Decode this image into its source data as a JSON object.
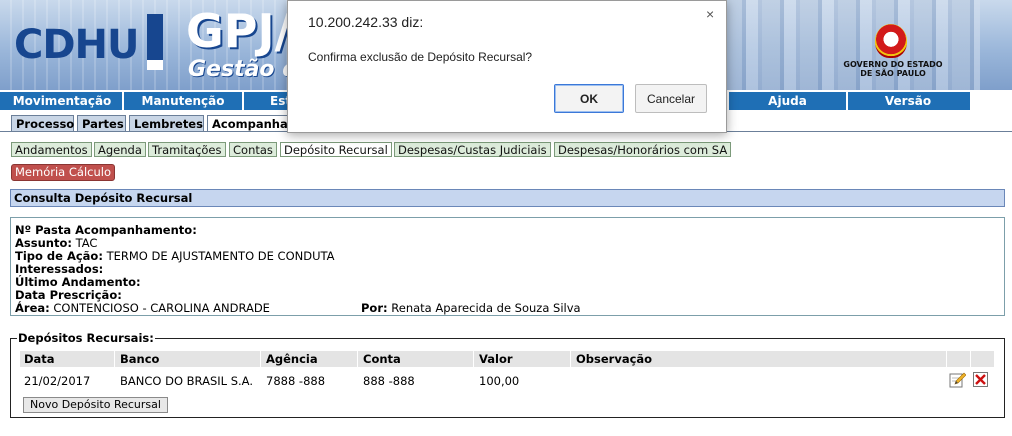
{
  "header": {
    "logo_left": "CDHU",
    "logo_main": "GPJ/",
    "logo_sub": "Gestão d",
    "gov_line1": "GOVERNO DO ESTADO",
    "gov_line2": "DE SÃO PAULO"
  },
  "menu": {
    "items": [
      {
        "label": "Movimentação"
      },
      {
        "label": "Manutenção"
      },
      {
        "label": "Est"
      },
      {
        "label": "Ajuda"
      },
      {
        "label": "Versão"
      }
    ]
  },
  "tabs": [
    {
      "label": "Processo"
    },
    {
      "label": "Partes"
    },
    {
      "label": "Lembretes"
    },
    {
      "label": "Acompanha"
    }
  ],
  "subtabs": [
    {
      "label": "Andamentos"
    },
    {
      "label": "Agenda"
    },
    {
      "label": "Tramitações"
    },
    {
      "label": "Contas"
    },
    {
      "label": "Depósito Recursal"
    },
    {
      "label": "Despesas/Custas Judiciais"
    },
    {
      "label": "Despesas/Honorários com SA"
    }
  ],
  "memoria_label": "Memória Cálculo",
  "consulta_title": "Consulta Depósito Recursal",
  "info": {
    "pasta_label": "Nº Pasta Acompanhamento:",
    "pasta_value": "",
    "assunto_label": "Assunto:",
    "assunto_value": "TAC",
    "tipo_label": "Tipo de Ação:",
    "tipo_value": "TERMO DE AJUSTAMENTO DE CONDUTA",
    "interessados_label": "Interessados:",
    "ultimo_label": "Último Andamento:",
    "prescricao_label": "Data Prescrição:",
    "area_label": "Área:",
    "area_value": "CONTENCIOSO - CAROLINA ANDRADE",
    "por_label": "Por:",
    "por_value": "Renata Aparecida de Souza Silva"
  },
  "depositos": {
    "legend": "Depósitos Recursais:",
    "columns": [
      "Data",
      "Banco",
      "Agência",
      "Conta",
      "Valor",
      "Observação"
    ],
    "rows": [
      {
        "data": "21/02/2017",
        "banco": "BANCO DO BRASIL S.A.",
        "agencia": "7888 -888",
        "conta": "888 -888",
        "valor": "100,00",
        "observacao": ""
      }
    ],
    "novo_button": "Novo Depósito  Recursal"
  },
  "dialog": {
    "origin": "10.200.242.33 diz:",
    "message": "Confirma exclusão de Depósito Recursal?",
    "ok_label": "OK",
    "cancel_label": "Cancelar",
    "close_glyph": "×"
  }
}
